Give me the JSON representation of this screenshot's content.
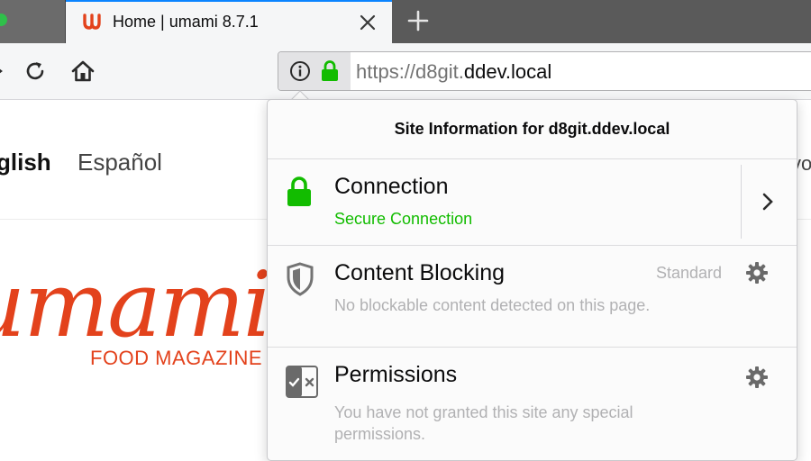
{
  "browser": {
    "tab_title": "Home | umami 8.7.1",
    "url_prefix": "https://d8git.",
    "url_domain": "ddev.local",
    "icons": [
      "close-icon",
      "plus-icon",
      "reload-icon",
      "home-icon",
      "info-icon",
      "lock-icon"
    ]
  },
  "page": {
    "lang_english": "glish",
    "lang_spanish": "Español",
    "lang_right": "vo",
    "brand_script": "umami",
    "brand_sub": "FOOD MAGAZINE"
  },
  "panel": {
    "title": "Site Information for d8git.ddev.local",
    "connection": {
      "title": "Connection",
      "status": "Secure Connection"
    },
    "content_blocking": {
      "title": "Content Blocking",
      "state": "Standard",
      "description": "No blockable content detected on this page."
    },
    "permissions": {
      "title": "Permissions",
      "description": "You have not granted this site any special permissions."
    }
  },
  "colors": {
    "accent_blue": "#0a84ff",
    "secure_green": "#12bc00",
    "brand_red": "#e3421c"
  }
}
